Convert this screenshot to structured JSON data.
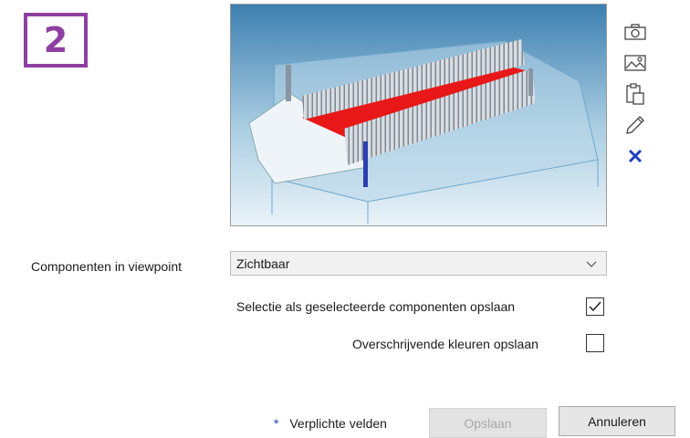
{
  "step": {
    "number": "2"
  },
  "viewpoint": {
    "image_label": "3D model viewpoint preview",
    "tools": [
      {
        "icon": "camera-icon"
      },
      {
        "icon": "image-icon"
      },
      {
        "icon": "clipboard-icon"
      },
      {
        "icon": "pencil-icon"
      },
      {
        "icon": "delete-icon",
        "color": "#1f3fbf"
      }
    ]
  },
  "form": {
    "components_label": "Componenten in viewpoint",
    "components_value": "Zichtbaar",
    "selection_label": "Selectie als geselecteerde componenten opslaan",
    "selection_checked": true,
    "colors_label": "Overschrijvende kleuren opslaan",
    "colors_checked": false
  },
  "footer": {
    "required_star": "*",
    "required_label": "Verplichte velden",
    "save_label": "Opslaan",
    "cancel_label": "Annuleren"
  },
  "colors": {
    "badge": "#8e3fa2",
    "accent_blue": "#1f3fbf",
    "highlight_red": "#e81818"
  }
}
